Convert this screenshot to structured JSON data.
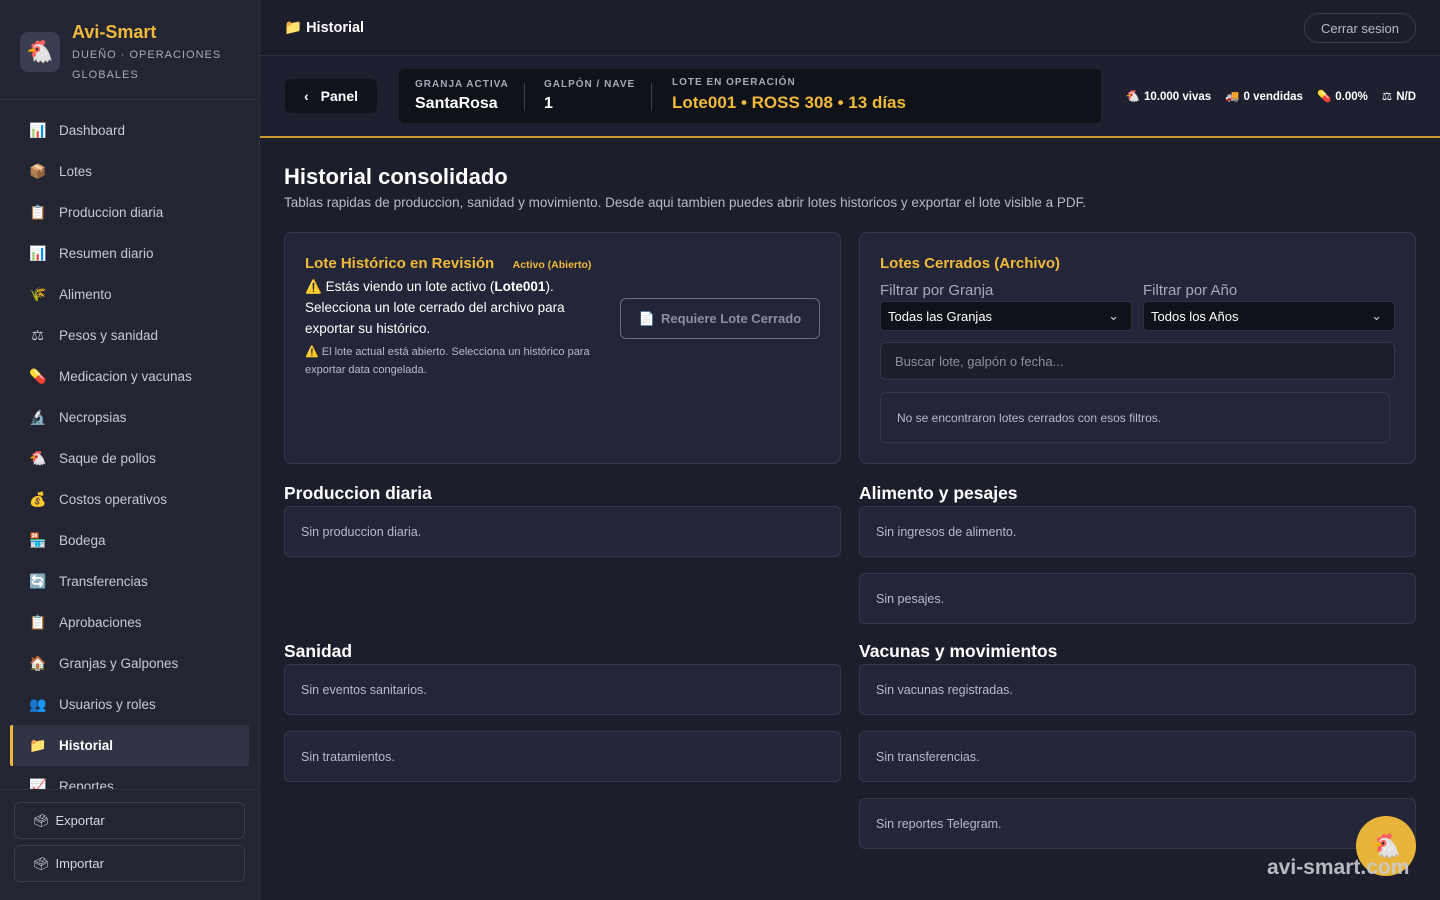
{
  "brand": {
    "name": "Avi-Smart",
    "subtitle": "DUEÑO · OPERACIONES GLOBALES",
    "logo_icon": "chicken-icon"
  },
  "sidebar": {
    "items": [
      {
        "label": "Dashboard",
        "icon": "📊",
        "name": "dashboard"
      },
      {
        "label": "Lotes",
        "icon": "📦",
        "name": "lotes"
      },
      {
        "label": "Produccion diaria",
        "icon": "📋",
        "name": "produccion-diaria"
      },
      {
        "label": "Resumen diario",
        "icon": "📊",
        "name": "resumen-diario"
      },
      {
        "label": "Alimento",
        "icon": "🌾",
        "name": "alimento"
      },
      {
        "label": "Pesos y sanidad",
        "icon": "⚖",
        "name": "pesos-sanidad"
      },
      {
        "label": "Medicacion y vacunas",
        "icon": "💊",
        "name": "medicacion-vacunas"
      },
      {
        "label": "Necropsias",
        "icon": "🔬",
        "name": "necropsias"
      },
      {
        "label": "Saque de pollos",
        "icon": "🐔",
        "name": "saque-pollos"
      },
      {
        "label": "Costos operativos",
        "icon": "💰",
        "name": "costos-operativos"
      },
      {
        "label": "Bodega",
        "icon": "🏪",
        "name": "bodega"
      },
      {
        "label": "Transferencias",
        "icon": "🔄",
        "name": "transferencias"
      },
      {
        "label": "Aprobaciones",
        "icon": "📋",
        "name": "aprobaciones"
      },
      {
        "label": "Granjas y Galpones",
        "icon": "🏠",
        "name": "granjas-galpones"
      },
      {
        "label": "Usuarios y roles",
        "icon": "👥",
        "name": "usuarios-roles"
      },
      {
        "label": "Historial",
        "icon": "📁",
        "name": "historial",
        "active": true
      },
      {
        "label": "Reportes",
        "icon": "📈",
        "name": "reportes"
      }
    ],
    "export_label": "Exportar",
    "import_label": "Importar"
  },
  "header": {
    "title": "Historial",
    "title_icon": "📁",
    "logout_label": "Cerrar sesion"
  },
  "context": {
    "back_label": "Panel",
    "farm_label": "GRANJA ACTIVA",
    "farm_value": "SantaRosa",
    "shed_label": "GALPÓN / NAVE",
    "shed_value": "1",
    "batch_label": "LOTE EN OPERACIÓN",
    "batch_value": "Lote001 • ROSS 308 • 13 días",
    "stats": [
      {
        "icon": "🐔",
        "text": "10.000 vivas"
      },
      {
        "icon": "🚚",
        "text": "0 vendidas"
      },
      {
        "icon": "💊",
        "text": "0.00%"
      },
      {
        "icon": "⚖",
        "text": "N/D"
      }
    ]
  },
  "page": {
    "title": "Historial consolidado",
    "description": "Tablas rapidas de produccion, sanidad y movimiento. Desde aqui tambien puedes abrir lotes historicos y exportar el lote visible a PDF."
  },
  "review_card": {
    "title": "Lote Histórico en Revisión",
    "badge": "Activo (Abierto)",
    "warning_pre": "Estás viendo un lote activo (",
    "warning_lot": "Lote001",
    "warning_post": "). Selecciona un lote cerrado del archivo para exportar su histórico.",
    "note": "El lote actual está abierto. Selecciona un histórico para exportar data congelada.",
    "button_label": "Requiere Lote Cerrado"
  },
  "archive_card": {
    "title": "Lotes Cerrados (Archivo)",
    "farm_filter_label": "Filtrar por Granja",
    "farm_filter_value": "Todas las Granjas",
    "year_filter_label": "Filtrar por Año",
    "year_filter_value": "Todos los Años",
    "search_placeholder": "Buscar lote, galpón o fecha...",
    "empty_text": "No se encontraron lotes cerrados con esos filtros."
  },
  "sections": {
    "produccion": {
      "title": "Produccion diaria",
      "empty": [
        "Sin produccion diaria."
      ]
    },
    "alimento": {
      "title": "Alimento y pesajes",
      "empty": [
        "Sin ingresos de alimento.",
        "Sin pesajes."
      ]
    },
    "sanidad": {
      "title": "Sanidad",
      "empty": [
        "Sin eventos sanitarios.",
        "Sin tratamientos."
      ]
    },
    "vacunas": {
      "title": "Vacunas y movimientos",
      "empty": [
        "Sin vacunas registradas.",
        "Sin transferencias.",
        "Sin reportes Telegram."
      ]
    }
  },
  "watermark": "avi-smart.com"
}
